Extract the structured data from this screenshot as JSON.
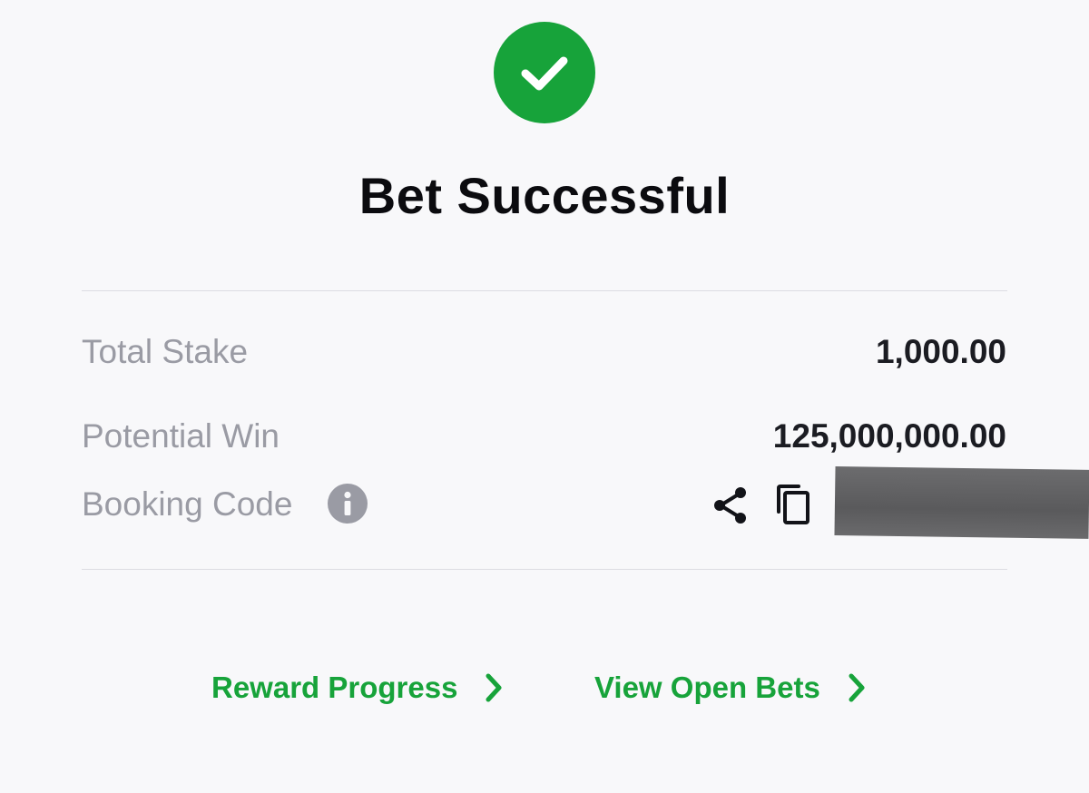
{
  "header": {
    "title": "Bet Successful",
    "status_icon": "check-circle-icon",
    "status_color": "#17a33a"
  },
  "summary": {
    "total_stake_label": "Total Stake",
    "total_stake_value": "1,000.00",
    "potential_win_label": "Potential Win",
    "potential_win_value": "125,000,000.00",
    "booking_code_label": "Booking Code",
    "booking_code_icons": [
      "info-icon",
      "share-icon",
      "copy-icon"
    ]
  },
  "actions": {
    "reward_progress_label": "Reward Progress",
    "view_open_bets_label": "View Open Bets",
    "link_color": "#17a33a"
  }
}
